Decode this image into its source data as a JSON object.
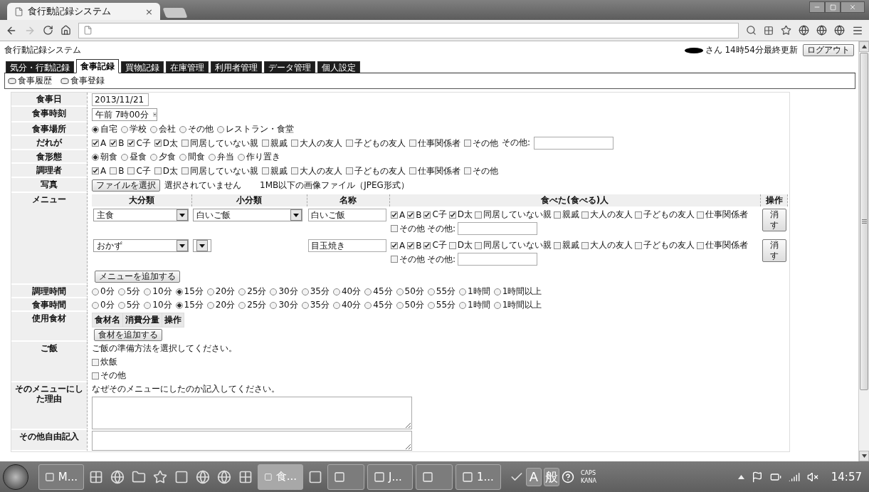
{
  "browser": {
    "tab_title": "食行動記録システム",
    "tab_close": "×"
  },
  "page": {
    "site_title": "食行動記録システム",
    "user_status": "さん 14時54分最終更新",
    "logout": "ログアウト"
  },
  "nav_tabs": [
    {
      "label": "気分・行動記録",
      "selected": false
    },
    {
      "label": "食事記録",
      "selected": true
    },
    {
      "label": "買物記録",
      "selected": false
    },
    {
      "label": "在庫管理",
      "selected": false
    },
    {
      "label": "利用者管理",
      "selected": false
    },
    {
      "label": "データ管理",
      "selected": false
    },
    {
      "label": "個人設定",
      "selected": false
    }
  ],
  "sub_actions": [
    {
      "label": "食事履歴"
    },
    {
      "label": "食事登録"
    }
  ],
  "form_rows": [
    {
      "kind": "input",
      "label": "食事日",
      "value": "2013/11/21"
    },
    {
      "kind": "select",
      "label": "食事時刻",
      "value": "午前 7時00分"
    },
    {
      "kind": "radio",
      "label": "食事場所",
      "options": [
        {
          "label": "自宅",
          "selected": true
        },
        {
          "label": "学校",
          "selected": false
        },
        {
          "label": "会社",
          "selected": false
        },
        {
          "label": "その他",
          "selected": false
        },
        {
          "label": "レストラン・食堂",
          "selected": false
        }
      ]
    },
    {
      "kind": "check",
      "label": "だれが",
      "other_label": "その他:",
      "options": [
        {
          "label": "A",
          "checked": true
        },
        {
          "label": "B",
          "checked": true
        },
        {
          "label": "C子",
          "checked": true
        },
        {
          "label": "D太",
          "checked": true
        },
        {
          "label": "同居していない親",
          "checked": false
        },
        {
          "label": "親戚",
          "checked": false
        },
        {
          "label": "大人の友人",
          "checked": false
        },
        {
          "label": "子どもの友人",
          "checked": false
        },
        {
          "label": "仕事関係者",
          "checked": false
        },
        {
          "label": "その他",
          "checked": false
        }
      ]
    },
    {
      "kind": "radio",
      "label": "食形態",
      "options": [
        {
          "label": "朝食",
          "selected": true
        },
        {
          "label": "昼食",
          "selected": false
        },
        {
          "label": "夕食",
          "selected": false
        },
        {
          "label": "間食",
          "selected": false
        },
        {
          "label": "弁当",
          "selected": false
        },
        {
          "label": "作り置き",
          "selected": false
        }
      ]
    },
    {
      "kind": "check",
      "label": "調理者",
      "options": [
        {
          "label": "A",
          "checked": true
        },
        {
          "label": "B",
          "checked": false
        },
        {
          "label": "C子",
          "checked": false
        },
        {
          "label": "D太",
          "checked": false
        },
        {
          "label": "同居していない親",
          "checked": false
        },
        {
          "label": "親戚",
          "checked": false
        },
        {
          "label": "大人の友人",
          "checked": false
        },
        {
          "label": "子どもの友人",
          "checked": false
        },
        {
          "label": "仕事関係者",
          "checked": false
        },
        {
          "label": "その他",
          "checked": false
        }
      ]
    },
    {
      "kind": "file",
      "label": "写真",
      "button": "ファイルを選択",
      "status": "選択されていません",
      "note": "1MB以下の画像ファイル（JPEG形式）"
    },
    {
      "kind": "menu",
      "label": "メニュー",
      "columns": [
        "大分類",
        "小分類",
        "名称",
        "食べた(食べる)人",
        "操作"
      ],
      "add_button": "メニューを追加する",
      "rows": [
        {
          "major": "主食",
          "minor": "白いご飯",
          "name": "白いご飯",
          "other_label": "その他:",
          "action": "消す",
          "people": [
            {
              "label": "A",
              "checked": true
            },
            {
              "label": "B",
              "checked": true
            },
            {
              "label": "C子",
              "checked": true
            },
            {
              "label": "D太",
              "checked": true
            },
            {
              "label": "同居していない親",
              "checked": false
            },
            {
              "label": "親戚",
              "checked": false
            },
            {
              "label": "大人の友人",
              "checked": false
            },
            {
              "label": "子どもの友人",
              "checked": false
            },
            {
              "label": "仕事関係者",
              "checked": false
            },
            {
              "label": "その他",
              "checked": false
            }
          ]
        },
        {
          "major": "おかず",
          "name": "目玉焼き",
          "other_label": "その他:",
          "action": "消す",
          "people": [
            {
              "label": "A",
              "checked": true
            },
            {
              "label": "B",
              "checked": true
            },
            {
              "label": "C子",
              "checked": true
            },
            {
              "label": "D太",
              "checked": false
            },
            {
              "label": "同居していない親",
              "checked": false
            },
            {
              "label": "親戚",
              "checked": false
            },
            {
              "label": "大人の友人",
              "checked": false
            },
            {
              "label": "子どもの友人",
              "checked": false
            },
            {
              "label": "仕事関係者",
              "checked": false
            },
            {
              "label": "その他",
              "checked": false
            }
          ]
        }
      ]
    },
    {
      "kind": "radio",
      "label": "調理時間",
      "options": [
        {
          "label": "0分",
          "selected": false
        },
        {
          "label": "5分",
          "selected": false
        },
        {
          "label": "10分",
          "selected": false
        },
        {
          "label": "15分",
          "selected": true
        },
        {
          "label": "20分",
          "selected": false
        },
        {
          "label": "25分",
          "selected": false
        },
        {
          "label": "30分",
          "selected": false
        },
        {
          "label": "35分",
          "selected": false
        },
        {
          "label": "40分",
          "selected": false
        },
        {
          "label": "45分",
          "selected": false
        },
        {
          "label": "50分",
          "selected": false
        },
        {
          "label": "55分",
          "selected": false
        },
        {
          "label": "1時間",
          "selected": false
        },
        {
          "label": "1時間以上",
          "selected": false
        }
      ]
    },
    {
      "kind": "radio",
      "label": "食事時間",
      "options": [
        {
          "label": "0分",
          "selected": false
        },
        {
          "label": "5分",
          "selected": false
        },
        {
          "label": "10分",
          "selected": false
        },
        {
          "label": "15分",
          "selected": true
        },
        {
          "label": "20分",
          "selected": false
        },
        {
          "label": "25分",
          "selected": false
        },
        {
          "label": "30分",
          "selected": false
        },
        {
          "label": "35分",
          "selected": false
        },
        {
          "label": "40分",
          "selected": false
        },
        {
          "label": "45分",
          "selected": false
        },
        {
          "label": "50分",
          "selected": false
        },
        {
          "label": "55分",
          "selected": false
        },
        {
          "label": "1時間",
          "selected": false
        },
        {
          "label": "1時間以上",
          "selected": false
        }
      ]
    },
    {
      "kind": "ingredients",
      "label": "使用食材",
      "columns": [
        "食材名",
        "消費分量",
        "操作"
      ],
      "add_button": "食材を追加する"
    },
    {
      "kind": "choices",
      "label": "ご飯",
      "prompt": "ご飯の準備方法を選択してください。",
      "options": [
        {
          "label": "炊飯",
          "checked": false
        },
        {
          "label": "その他",
          "checked": false
        }
      ]
    },
    {
      "kind": "textarea",
      "label": "そのメニューにした理由",
      "prompt": "なぜそのメニューにしたのか記入してください。"
    },
    {
      "kind": "textarea",
      "label": "その他自由記入"
    }
  ],
  "taskbar": {
    "items": [
      {
        "kind": "task",
        "label": "M...",
        "selected": false
      },
      {
        "kind": "pinned"
      },
      {
        "kind": "pinned"
      },
      {
        "kind": "pinned"
      },
      {
        "kind": "pinned"
      },
      {
        "kind": "pinned"
      },
      {
        "kind": "pinned"
      },
      {
        "kind": "pinned"
      },
      {
        "kind": "pinned"
      },
      {
        "kind": "task",
        "label": "食...",
        "selected": true
      },
      {
        "kind": "pinned"
      },
      {
        "kind": "task",
        "selected": false
      },
      {
        "kind": "task",
        "label": "J...",
        "selected": false
      },
      {
        "kind": "task",
        "selected": false
      },
      {
        "kind": "task",
        "label": "1...",
        "selected": false
      }
    ],
    "ime_keys": [
      "A",
      "般"
    ],
    "caps": "CAPS",
    "kana": "KANA",
    "clock": "14:57"
  }
}
